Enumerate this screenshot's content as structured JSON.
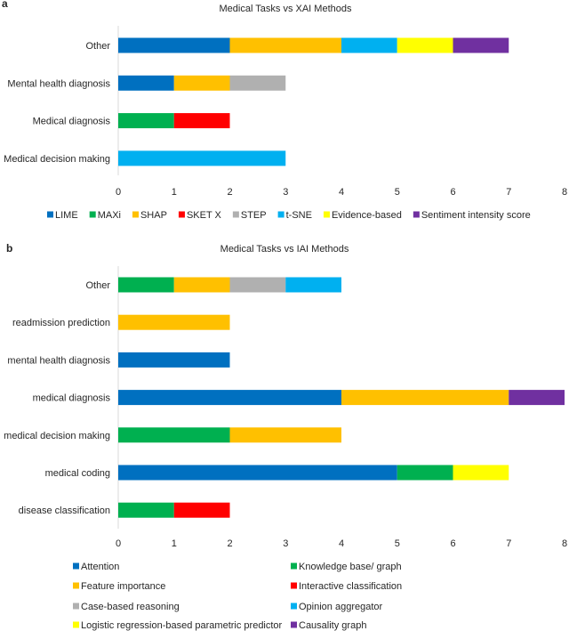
{
  "chart_data": [
    {
      "type": "bar",
      "orientation": "horizontal",
      "stacked": true,
      "panel": "a",
      "title": "Medical Tasks vs XAI Methods",
      "xlabel": "",
      "ylabel": "",
      "xlim": [
        0,
        8
      ],
      "xticks": [
        0,
        1,
        2,
        3,
        4,
        5,
        6,
        7,
        8
      ],
      "grid": false,
      "legend_position": "bottom",
      "categories": [
        "Other",
        "Mental health diagnosis",
        "Medical diagnosis",
        "Medical decision making"
      ],
      "series": [
        {
          "name": "LIME",
          "color": "#0070C0",
          "values": [
            2,
            1,
            0,
            0
          ]
        },
        {
          "name": "MAXi",
          "color": "#00B050",
          "values": [
            0,
            0,
            1,
            0
          ]
        },
        {
          "name": "SHAP",
          "color": "#FFC000",
          "values": [
            2,
            1,
            0,
            0
          ]
        },
        {
          "name": "SKET X",
          "color": "#FF0000",
          "values": [
            0,
            0,
            1,
            0
          ]
        },
        {
          "name": "STEP",
          "color": "#B0B0B0",
          "values": [
            0,
            1,
            0,
            0
          ]
        },
        {
          "name": "t-SNE",
          "color": "#00B0F0",
          "values": [
            1,
            0,
            0,
            3
          ]
        },
        {
          "name": "Evidence-based",
          "color": "#FFFF00",
          "values": [
            1,
            0,
            0,
            0
          ]
        },
        {
          "name": "Sentiment intensity score",
          "color": "#7030A0",
          "values": [
            1,
            0,
            0,
            0
          ]
        }
      ]
    },
    {
      "type": "bar",
      "orientation": "horizontal",
      "stacked": true,
      "panel": "b",
      "title": "Medical Tasks vs IAI Methods",
      "xlabel": "",
      "ylabel": "",
      "xlim": [
        0,
        8
      ],
      "xticks": [
        0,
        1,
        2,
        3,
        4,
        5,
        6,
        7,
        8
      ],
      "grid": false,
      "legend_position": "bottom",
      "categories": [
        "Other",
        "readmission prediction",
        "mental health diagnosis",
        "medical diagnosis",
        "medical decision making",
        "medical coding",
        "disease classification"
      ],
      "series": [
        {
          "name": "Attention",
          "color": "#0070C0",
          "values": [
            0,
            0,
            2,
            4,
            0,
            5,
            0
          ]
        },
        {
          "name": "Knowledge base/ graph",
          "color": "#00B050",
          "values": [
            1,
            0,
            0,
            0,
            2,
            1,
            1
          ]
        },
        {
          "name": "Feature importance",
          "color": "#FFC000",
          "values": [
            1,
            2,
            0,
            3,
            2,
            0,
            0
          ]
        },
        {
          "name": "Interactive classification",
          "color": "#FF0000",
          "values": [
            0,
            0,
            0,
            0,
            0,
            0,
            1
          ]
        },
        {
          "name": "Case-based reasoning",
          "color": "#B0B0B0",
          "values": [
            1,
            0,
            0,
            0,
            0,
            0,
            0
          ]
        },
        {
          "name": "Opinion aggregator",
          "color": "#00B0F0",
          "values": [
            1,
            0,
            0,
            0,
            0,
            0,
            0
          ]
        },
        {
          "name": "Logistic regression-based parametric predictor",
          "color": "#FFFF00",
          "values": [
            0,
            0,
            0,
            0,
            0,
            1,
            0
          ]
        },
        {
          "name": "Causality graph",
          "color": "#7030A0",
          "values": [
            0,
            0,
            0,
            1,
            0,
            0,
            0
          ]
        }
      ]
    }
  ]
}
